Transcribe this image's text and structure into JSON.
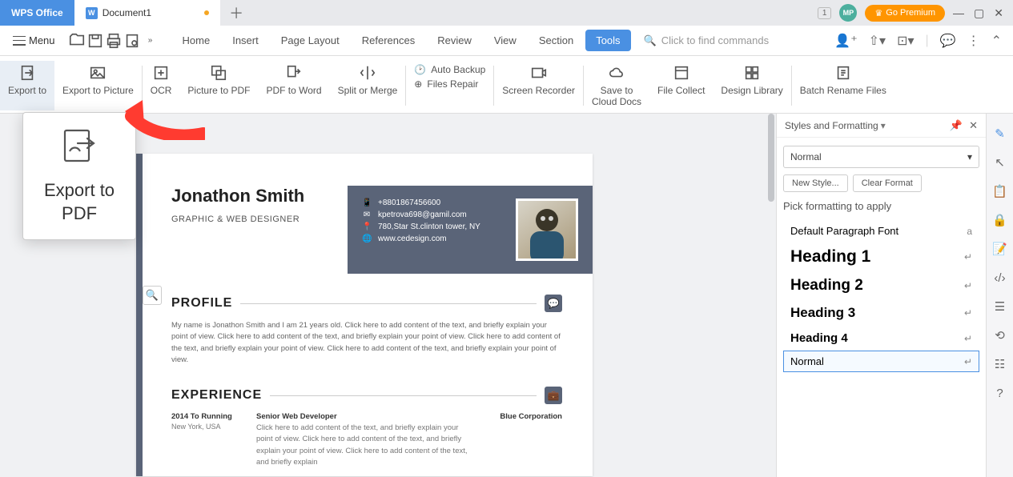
{
  "title_bar": {
    "wps_label": "WPS Office",
    "doc_label": "Document1",
    "one_badge": "1",
    "avatar_initials": "MP",
    "premium_label": "Go Premium"
  },
  "menu": {
    "label": "Menu",
    "tabs": [
      "Home",
      "Insert",
      "Page Layout",
      "References",
      "Review",
      "View",
      "Section",
      "Tools"
    ],
    "active_tab": "Tools",
    "search_placeholder": "Click to find commands"
  },
  "ribbon": {
    "export_to": "Export to",
    "export_picture": "Export to Picture",
    "ocr": "OCR",
    "picture_pdf": "Picture to PDF",
    "pdf_word": "PDF to Word",
    "split_merge": "Split or Merge",
    "auto_backup": "Auto Backup",
    "files_repair": "Files Repair",
    "screen_recorder": "Screen Recorder",
    "save_cloud_l1": "Save to",
    "save_cloud_l2": "Cloud Docs",
    "file_collect": "File Collect",
    "design_library": "Design Library",
    "batch_rename": "Batch Rename Files"
  },
  "popup": {
    "line1": "Export to",
    "line2": "PDF"
  },
  "document": {
    "name": "Jonathon Smith",
    "role": "GRAPHIC & WEB DESIGNER",
    "contacts": {
      "phone": "+8801867456600",
      "email": "kpetrova698@gamil.com",
      "address": "780,Star St.clinton tower, NY",
      "website": "www.cedesign.com"
    },
    "profile_title": "PROFILE",
    "profile_body": "My name is Jonathon Smith and I am 21 years old. Click here to add content of the text, and briefly explain your point of view. Click here to add content of the text, and briefly explain your point of view. Click here to add content of the text, and briefly explain your point of view. Click here to add content of the text, and briefly explain your point of view.",
    "experience_title": "EXPERIENCE",
    "exp": {
      "period": "2014 To Running",
      "loc": "New York, USA",
      "title": "Senior Web Developer",
      "body": "Click here to add content of the text, and briefly explain your point of view. Click here to add content of the text, and briefly explain your point of view. Click here to add content of the text, and briefly explain",
      "company": "Blue Corporation"
    }
  },
  "styles_panel": {
    "title": "Styles and Formatting",
    "select_value": "Normal",
    "new_style": "New Style...",
    "clear_format": "Clear Format",
    "pick_label": "Pick formatting to apply",
    "items": [
      {
        "label": "Default Paragraph Font",
        "class": "default-font",
        "glyph": "a"
      },
      {
        "label": "Heading 1",
        "class": "h1",
        "glyph": "↵"
      },
      {
        "label": "Heading 2",
        "class": "h2",
        "glyph": "↵"
      },
      {
        "label": "Heading 3",
        "class": "h3",
        "glyph": "↵"
      },
      {
        "label": "Heading 4",
        "class": "h4",
        "glyph": "↵"
      },
      {
        "label": "Normal",
        "class": "normal",
        "glyph": "↵",
        "selected": true
      }
    ]
  }
}
